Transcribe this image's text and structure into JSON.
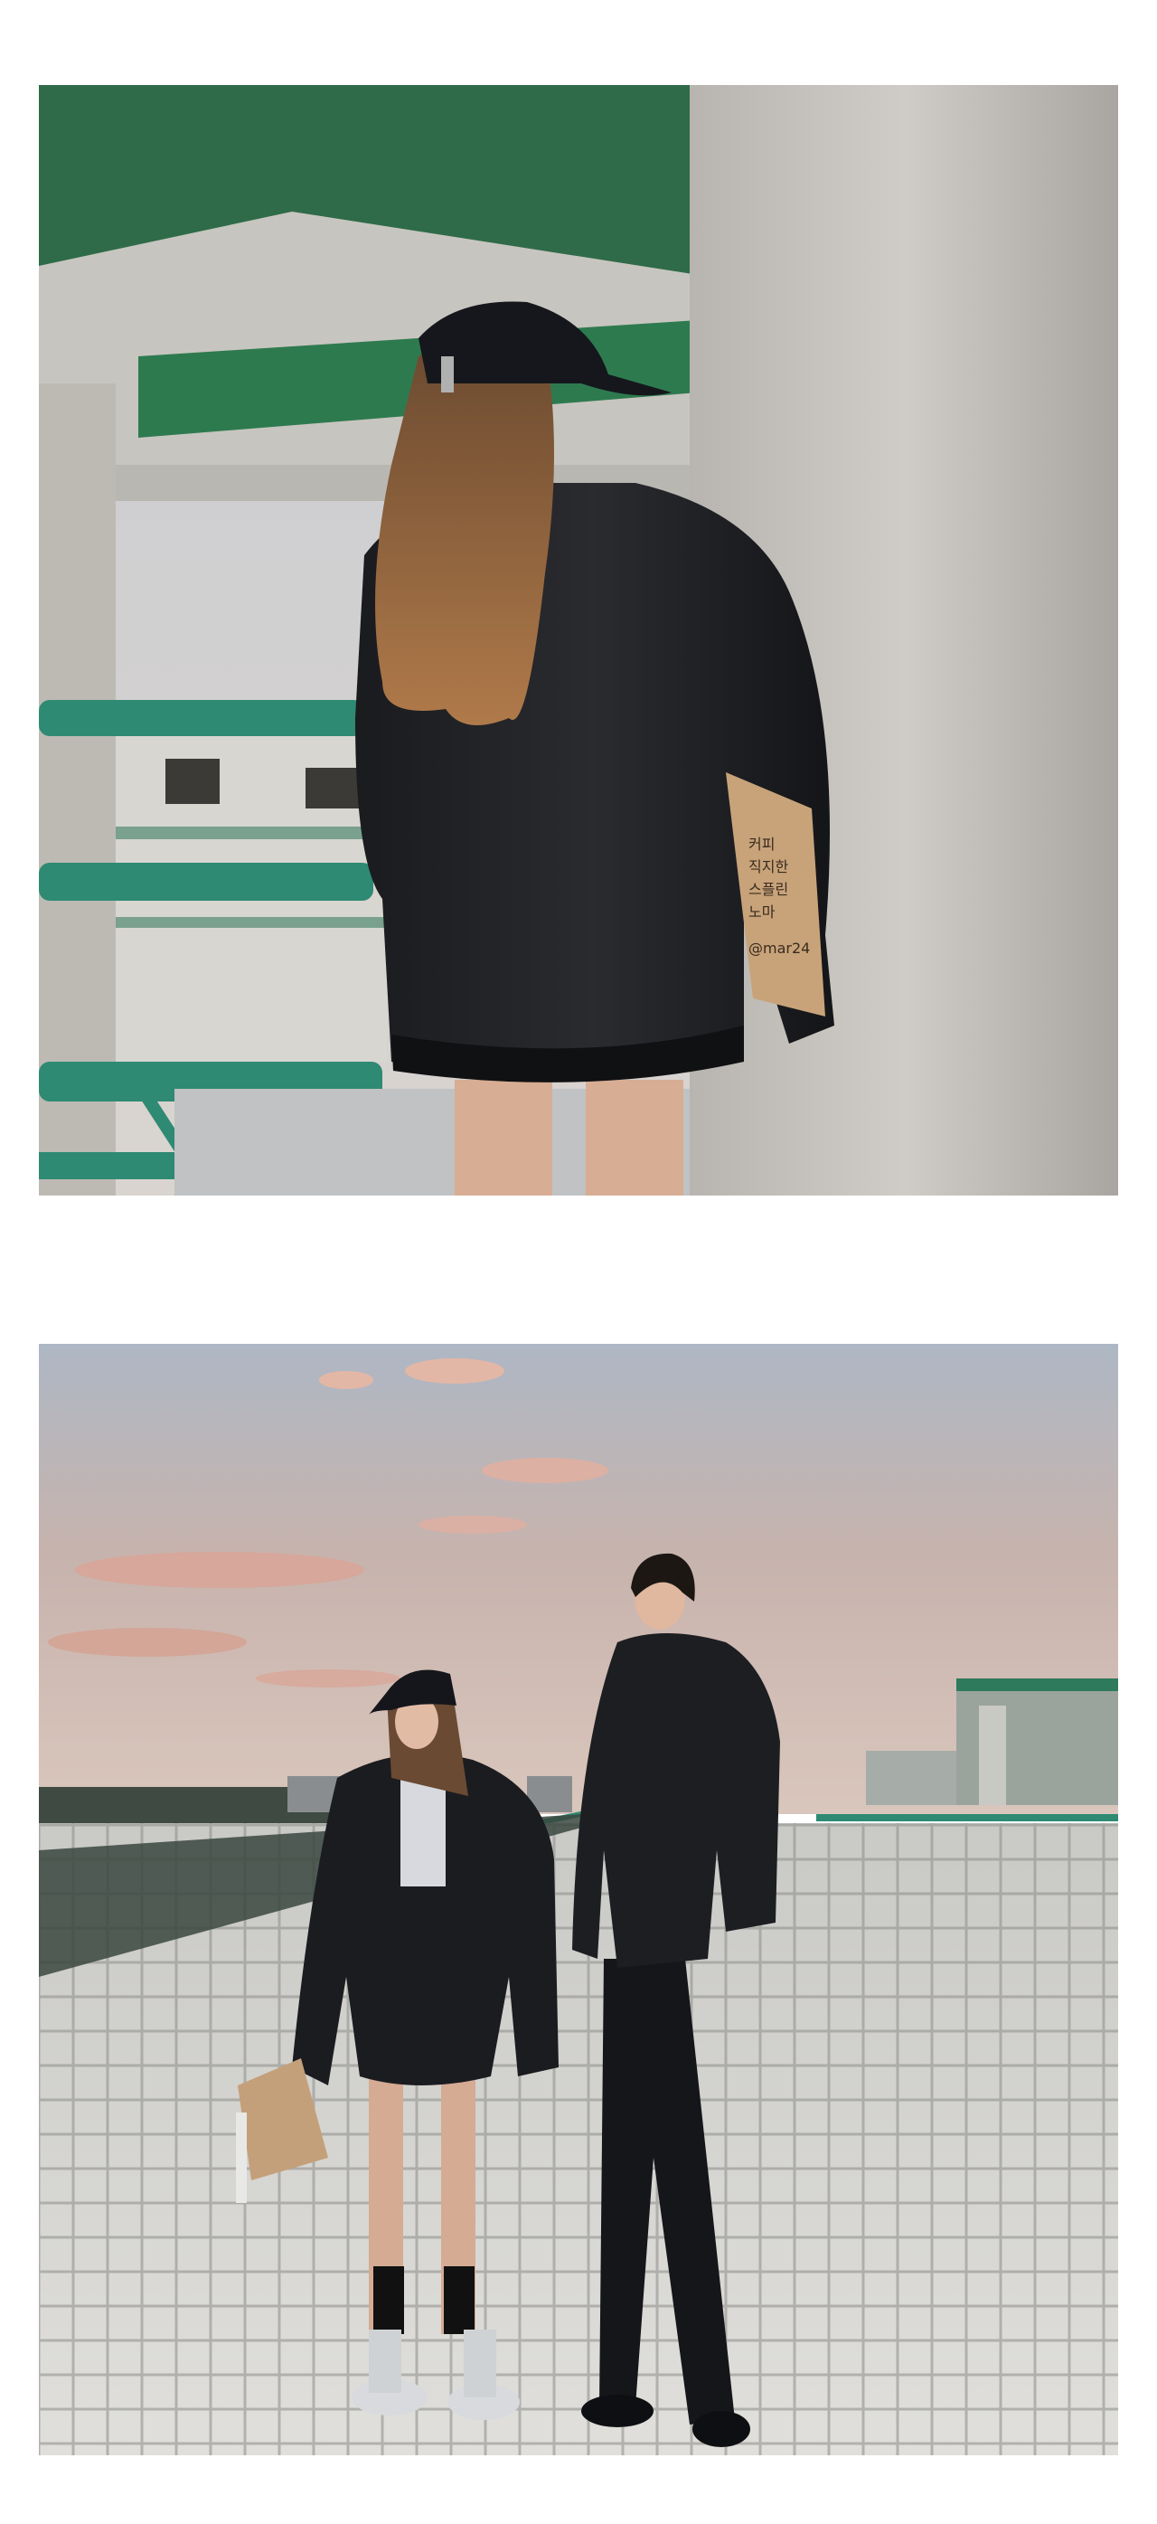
{
  "page": {
    "background": "#ffffff"
  },
  "photos": [
    {
      "subject": "woman-back-view-leather-jacket",
      "bag_text": [
        "커피",
        "직지한",
        "스플린",
        "노마",
        "@mar24"
      ]
    },
    {
      "subject": "couple-rooftop-sunset"
    }
  ]
}
